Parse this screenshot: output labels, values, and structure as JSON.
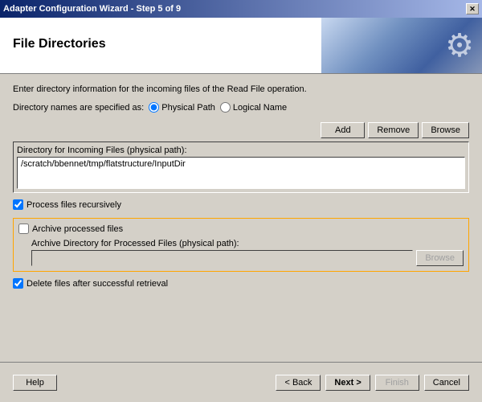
{
  "window": {
    "title": "Adapter Configuration Wizard - Step 5 of 9",
    "close_btn": "✕"
  },
  "header": {
    "title": "File Directories"
  },
  "body": {
    "info_text": "Enter directory information for the incoming files of the Read File operation.",
    "directory_names_label": "Directory names are specified as:",
    "physical_path_label": "Physical Path",
    "logical_name_label": "Logical Name",
    "add_btn": "Add",
    "remove_btn": "Remove",
    "browse_btn1": "Browse",
    "dir_incoming_label": "Directory for Incoming Files (physical path):",
    "dir_incoming_value": "/scratch/bbennet/tmp/flatstructure/InputDir",
    "process_recursively_label": "Process files recursively",
    "archive_label": "Archive processed files",
    "archive_dir_label": "Archive Directory for Processed Files (physical path):",
    "archive_input_placeholder": "",
    "browse_btn2": "Browse",
    "delete_files_label": "Delete files after successful retrieval"
  },
  "footer": {
    "help_btn": "Help",
    "back_btn": "< Back",
    "next_btn": "Next >",
    "finish_btn": "Finish",
    "cancel_btn": "Cancel"
  },
  "state": {
    "physical_path_selected": true,
    "logical_name_selected": false,
    "process_recursively_checked": true,
    "archive_checked": false,
    "delete_files_checked": true,
    "finish_disabled": true
  }
}
